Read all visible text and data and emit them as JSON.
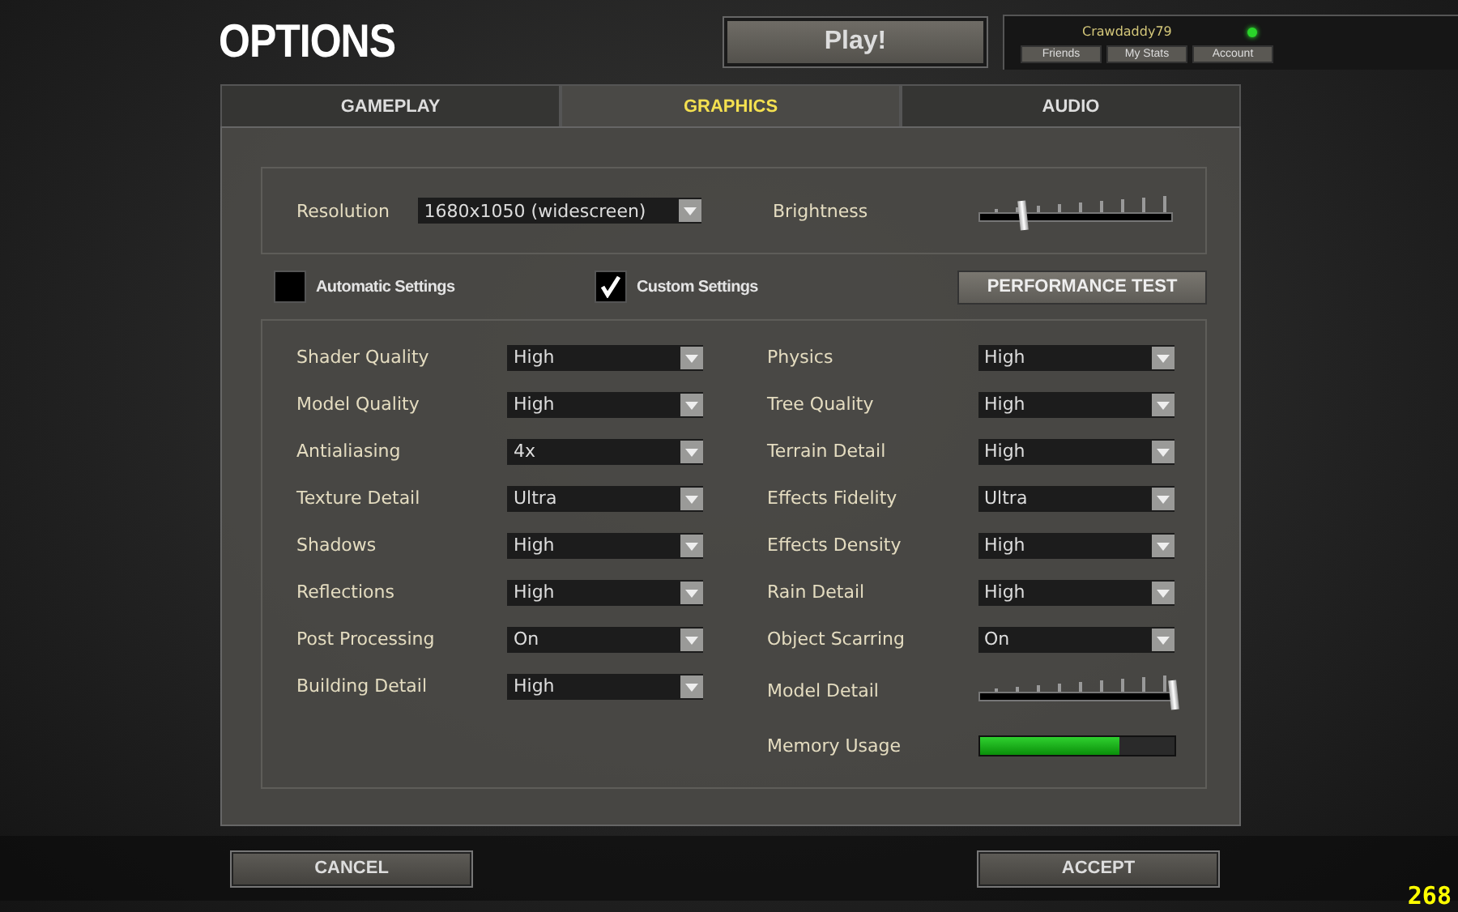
{
  "header": {
    "title": "OPTIONS",
    "play_button": "Play!"
  },
  "user": {
    "name": "Crawdaddy79",
    "online": true,
    "buttons": [
      "Friends",
      "My Stats",
      "Account"
    ]
  },
  "tabs": [
    {
      "label": "GAMEPLAY",
      "selected": false
    },
    {
      "label": "GRAPHICS",
      "selected": true
    },
    {
      "label": "AUDIO",
      "selected": false
    }
  ],
  "resolution": {
    "label": "Resolution",
    "value": "1680x1050 (widescreen)"
  },
  "brightness": {
    "label": "Brightness",
    "level": 0.23
  },
  "modes": [
    {
      "label": "Automatic Settings",
      "checked": false
    },
    {
      "label": "Custom Settings",
      "checked": true
    }
  ],
  "performance_button": "PERFORMANCE TEST",
  "left_settings": [
    {
      "kind": "dropdown",
      "label": "Shader Quality",
      "value": "High"
    },
    {
      "kind": "dropdown",
      "label": "Model Quality",
      "value": "High"
    },
    {
      "kind": "dropdown",
      "label": "Antialiasing",
      "value": "4x"
    },
    {
      "kind": "dropdown",
      "label": "Texture Detail",
      "value": "Ultra"
    },
    {
      "kind": "dropdown",
      "label": "Shadows",
      "value": "High"
    },
    {
      "kind": "dropdown",
      "label": "Reflections",
      "value": "High"
    },
    {
      "kind": "dropdown",
      "label": "Post Processing",
      "value": "On"
    },
    {
      "kind": "dropdown",
      "label": "Building Detail",
      "value": "High"
    }
  ],
  "right_settings": [
    {
      "kind": "dropdown",
      "label": "Physics",
      "value": "High"
    },
    {
      "kind": "dropdown",
      "label": "Tree Quality",
      "value": "High"
    },
    {
      "kind": "dropdown",
      "label": "Terrain Detail",
      "value": "High"
    },
    {
      "kind": "dropdown",
      "label": "Effects Fidelity",
      "value": "Ultra"
    },
    {
      "kind": "dropdown",
      "label": "Effects Density",
      "value": "High"
    },
    {
      "kind": "dropdown",
      "label": "Rain Detail",
      "value": "High"
    },
    {
      "kind": "dropdown",
      "label": "Object Scarring",
      "value": "On"
    },
    {
      "kind": "slider",
      "label": "Model Detail",
      "level": 1
    },
    {
      "kind": "meter",
      "label": "Memory Usage",
      "level": 0.72
    }
  ],
  "footer": {
    "cancel": "CANCEL",
    "accept": "ACCEPT",
    "fps": "268"
  }
}
